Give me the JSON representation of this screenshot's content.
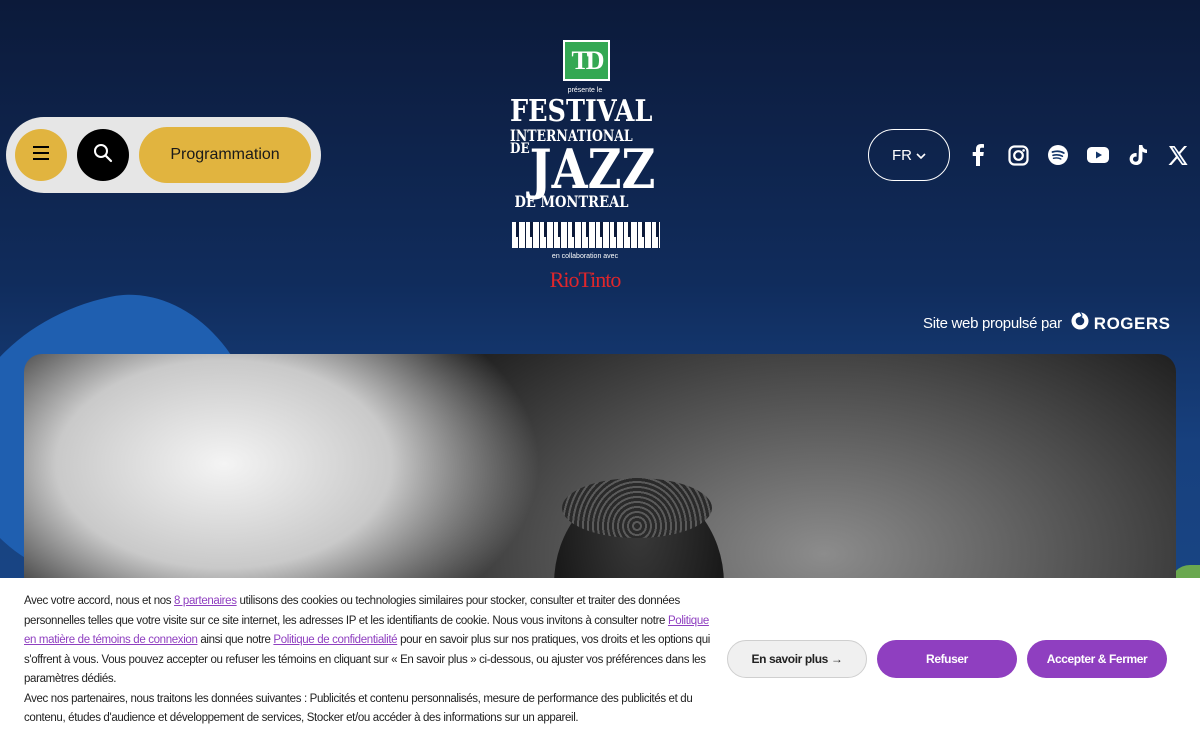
{
  "header": {
    "menu_icon": "hamburger-icon",
    "search_icon": "search-icon",
    "programmation_label": "Programmation",
    "language_label": "FR",
    "language_icon": "chevron-down-icon"
  },
  "logo": {
    "sponsor_mark": "TD",
    "presents": "présente le",
    "line1": "FESTIVAL",
    "line2": "INTERNATIONAL",
    "line3": "JAZZ",
    "line3_prefix": "DE",
    "line4": "DE MONTREAL",
    "md": "MD",
    "collab": "en collaboration avec",
    "partner": "RioTinto"
  },
  "social": [
    {
      "name": "facebook-icon"
    },
    {
      "name": "instagram-icon"
    },
    {
      "name": "spotify-icon"
    },
    {
      "name": "youtube-icon"
    },
    {
      "name": "tiktok-icon"
    },
    {
      "name": "x-icon"
    }
  ],
  "powered": {
    "text": "Site web propulsé par",
    "brand": "ROGERS"
  },
  "cookie": {
    "p1_a": "Avec votre accord, nous et nos ",
    "p1_link": "8 partenaires",
    "p1_b": " utilisons des cookies ou technologies similaires pour stocker, consulter et traiter des données personnelles telles que votre visite sur ce site internet, les adresses IP et les identifiants de cookie. Nous vous invitons à consulter notre ",
    "p1_link2": "Politique en matière de témoins de connexion",
    "p1_c": " ainsi que notre ",
    "p1_link3": "Politique de confidentialité",
    "p1_d": " pour en savoir plus sur nos pratiques, vos droits et les options qui s'offrent à vous. Vous pouvez accepter ou refuser les témoins en cliquant sur « En savoir plus » ci-dessous, ou ajuster vos préférences dans les paramètres dédiés.",
    "p2": "Avec nos partenaires, nous traitons les données suivantes : Publicités et contenu personnalisés, mesure de performance des publicités et du contenu, études d'audience et développement de services, Stocker et/ou accéder à des informations sur un appareil.",
    "more_label": "En savoir plus →",
    "refuse_label": "Refuser",
    "accept_label": "Accepter & Fermer"
  }
}
